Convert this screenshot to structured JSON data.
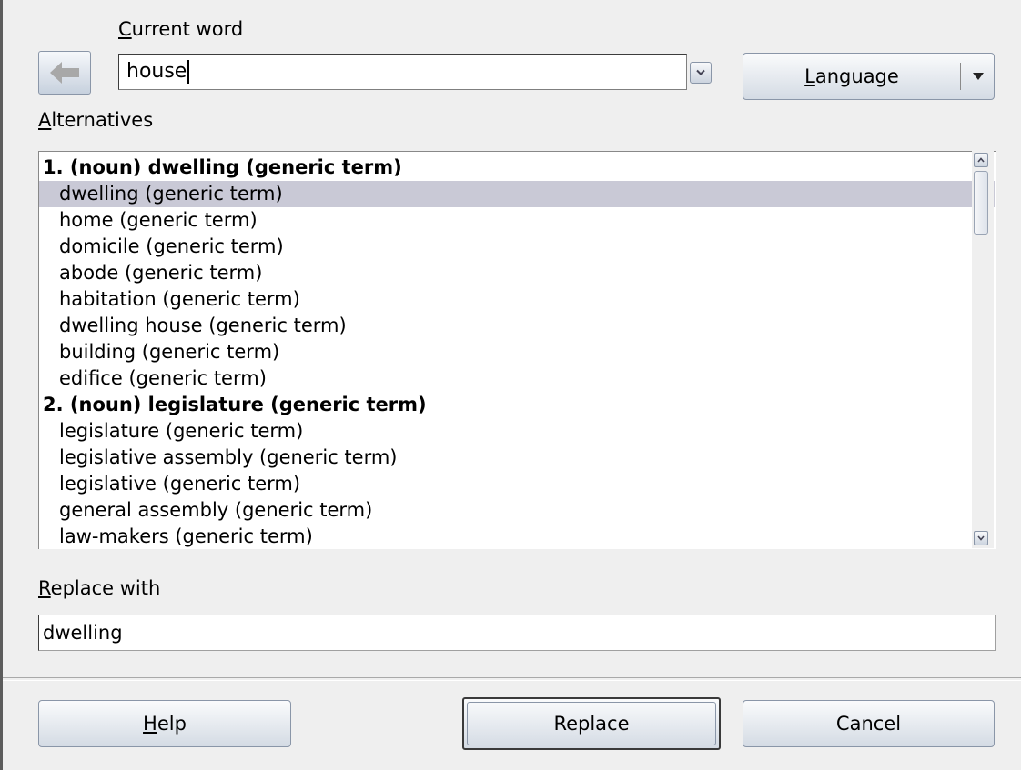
{
  "current_word": {
    "label": "Current word",
    "value": "house"
  },
  "language_button": {
    "label": "Language"
  },
  "alternatives": {
    "label": "Alternatives",
    "items": [
      {
        "text": "1. (noun) dwelling (generic term)",
        "kind": "head",
        "selected": false
      },
      {
        "text": "dwelling (generic term)",
        "kind": "sub",
        "selected": true
      },
      {
        "text": "home (generic term)",
        "kind": "sub",
        "selected": false
      },
      {
        "text": "domicile (generic term)",
        "kind": "sub",
        "selected": false
      },
      {
        "text": "abode (generic term)",
        "kind": "sub",
        "selected": false
      },
      {
        "text": "habitation (generic term)",
        "kind": "sub",
        "selected": false
      },
      {
        "text": "dwelling house (generic term)",
        "kind": "sub",
        "selected": false
      },
      {
        "text": "building (generic term)",
        "kind": "sub",
        "selected": false
      },
      {
        "text": "edifice (generic term)",
        "kind": "sub",
        "selected": false
      },
      {
        "text": "2. (noun) legislature (generic term)",
        "kind": "head",
        "selected": false
      },
      {
        "text": "legislature (generic term)",
        "kind": "sub",
        "selected": false
      },
      {
        "text": "legislative assembly (generic term)",
        "kind": "sub",
        "selected": false
      },
      {
        "text": "legislative (generic term)",
        "kind": "sub",
        "selected": false
      },
      {
        "text": "general assembly (generic term)",
        "kind": "sub",
        "selected": false
      },
      {
        "text": "law-makers (generic term)",
        "kind": "sub",
        "selected": false
      }
    ]
  },
  "replace_with": {
    "label": "Replace with",
    "value": "dwelling"
  },
  "buttons": {
    "help": "Help",
    "replace": "Replace",
    "cancel": "Cancel"
  },
  "colors": {
    "selection": "#c9c9d6",
    "background": "#efefef",
    "button_gradient_bottom": "#d4dbe4"
  },
  "icons": {
    "back": "arrow-left-icon",
    "dropdown": "chevron-down-icon",
    "scroll_up": "scroll-up-arrow-icon",
    "scroll_down": "scroll-down-arrow-icon"
  }
}
